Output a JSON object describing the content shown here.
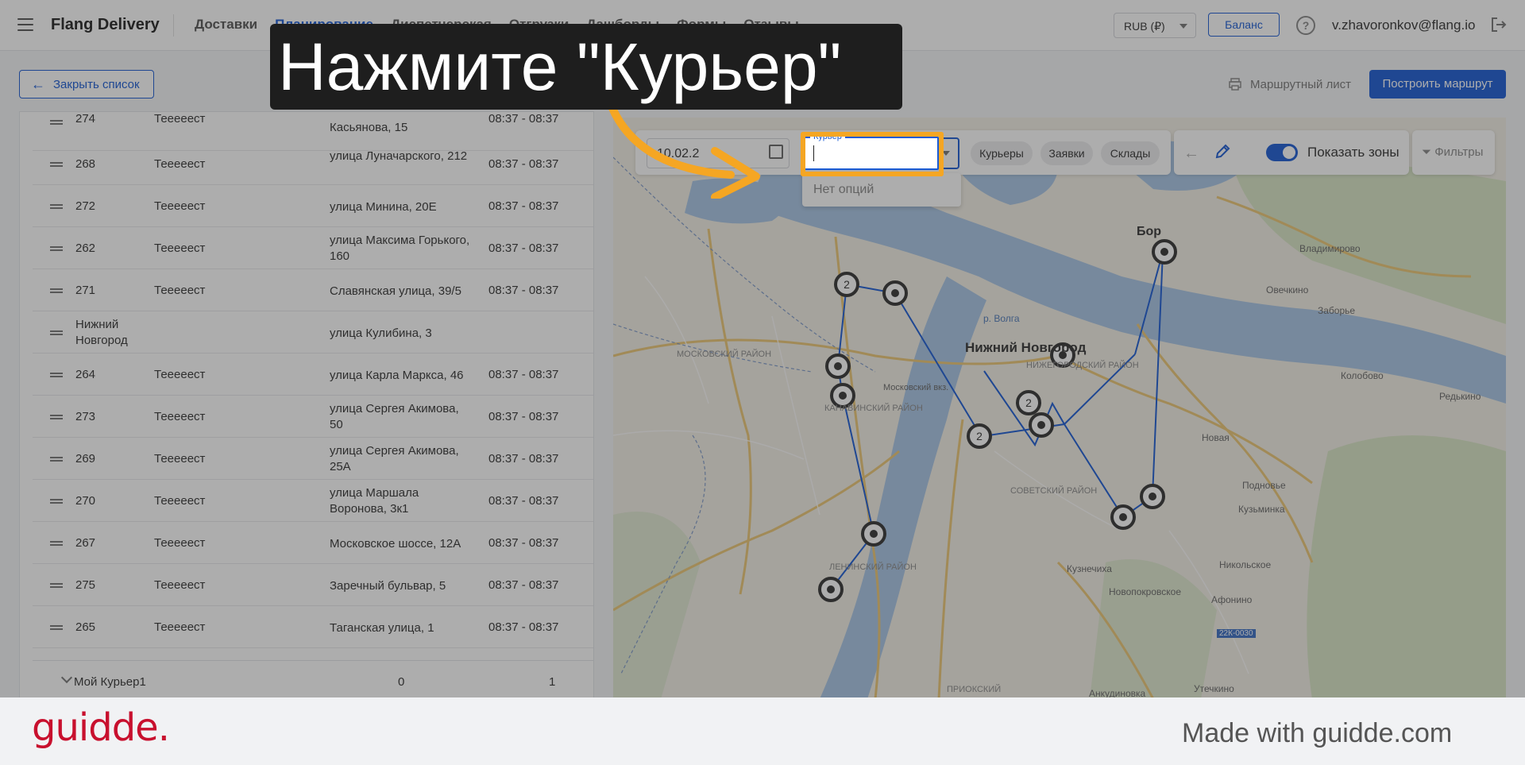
{
  "header": {
    "brand": "Flang Delivery",
    "nav": [
      "Доставки",
      "Планирование",
      "Диспетчерская",
      "Отгрузки",
      "Дашборды",
      "Формы",
      "Отзывы"
    ],
    "active_nav": "Планирование",
    "currency": "RUB (₽)",
    "balance_label": "Баланс",
    "user_email": "v.zhavoronkov@flang.io"
  },
  "toolbar": {
    "close_list_label": "Закрыть список",
    "route_sheet_label": "Маршрутный лист",
    "build_route_label": "Построить маршрут"
  },
  "orders": [
    {
      "num": "274",
      "name": "Теееeест",
      "address": "Касьянова, 15",
      "time": "08:37 - 08:37"
    },
    {
      "num": "268",
      "name": "Теееeест",
      "address": "улица Луначарского, 212",
      "time": "08:37 - 08:37"
    },
    {
      "num": "272",
      "name": "Теееeест",
      "address": "улица Минина, 20Е",
      "time": "08:37 - 08:37"
    },
    {
      "num": "262",
      "name": "Теееeест",
      "address": "улица Максима Горького, 160",
      "time": "08:37 - 08:37"
    },
    {
      "num": "271",
      "name": "Теееeест",
      "address": "Славянская улица, 39/5",
      "time": "08:37 - 08:37"
    },
    {
      "num": "Нижний Новгород",
      "name": "",
      "address": "улица Кулибина, 3",
      "time": ""
    },
    {
      "num": "264",
      "name": "Теееeест",
      "address": "улица Карла Маркса, 46",
      "time": "08:37 - 08:37"
    },
    {
      "num": "273",
      "name": "Теееeест",
      "address": "улица Сергея Акимова, 50",
      "time": "08:37 - 08:37"
    },
    {
      "num": "269",
      "name": "Теееeест",
      "address": "улица Сергея Акимова, 25А",
      "time": "08:37 - 08:37"
    },
    {
      "num": "270",
      "name": "Теееeест",
      "address": "улица Маршала Воронова, 3к1",
      "time": "08:37 - 08:37"
    },
    {
      "num": "267",
      "name": "Теееeест",
      "address": "Московское шоссе, 12А",
      "time": "08:37 - 08:37"
    },
    {
      "num": "275",
      "name": "Теееeест",
      "address": "Заречный бульвар, 5",
      "time": "08:37 - 08:37"
    },
    {
      "num": "265",
      "name": "Теееeест",
      "address": "Таганская улица, 1",
      "time": "08:37 - 08:37"
    }
  ],
  "courier_summary": {
    "name": "Мой Курьер1",
    "col1": "0",
    "col2": "1"
  },
  "map_controls": {
    "date": "10.02.2",
    "courier_label": "Курьер",
    "no_options": "Нет опций",
    "chips": [
      "Курьеры",
      "Заявки",
      "Склады"
    ],
    "show_zones_label": "Показать зоны",
    "filters_label": "Фильтры"
  },
  "map_labels": {
    "city": "Нижний Новгород",
    "bor": "Бор",
    "vladimirovo": "Владимирово",
    "ovechkino": "Овечкино",
    "zaborye": "Заборье",
    "kolobovo": "Колобово",
    "redkinsk": "Редькино",
    "novaya": "Новая",
    "podnovye": "Подновье",
    "kuzminka": "Кузьминка",
    "nikolskoe": "Никольское",
    "afonino": "Афонино",
    "kuznechikha": "Кузнечиха",
    "novopokrovskoe": "Новопокровское",
    "utechkino": "Утечкино",
    "ankudinovka": "Анкудиновка",
    "volga": "р. Волга",
    "moskovsky": "МОСКОВСКИЙ РАЙОН",
    "kanavinsky": "КАНАВИНСКИЙ РАЙОН",
    "nizhegorodsky": "НИЖЕГОРОДСКИЙ РАЙОН",
    "sovetsky": "СОВЕТСКИЙ РАЙОН",
    "leninsky": "ЛЕНИНСКИЙ РАЙОН",
    "prioksky": "ПРИОКСКИЙ",
    "moskovsky_vkz": "Московский вкз.",
    "highway": "22К-0030"
  },
  "tutorial": {
    "tooltip": "Нажмите \"Курьер\"",
    "footer_logo": "guidde.",
    "footer_text": "Made with guidde.com"
  },
  "colors": {
    "accent": "#1a5bd4",
    "highlight": "#f5a623",
    "brand_red": "#c8102e"
  }
}
